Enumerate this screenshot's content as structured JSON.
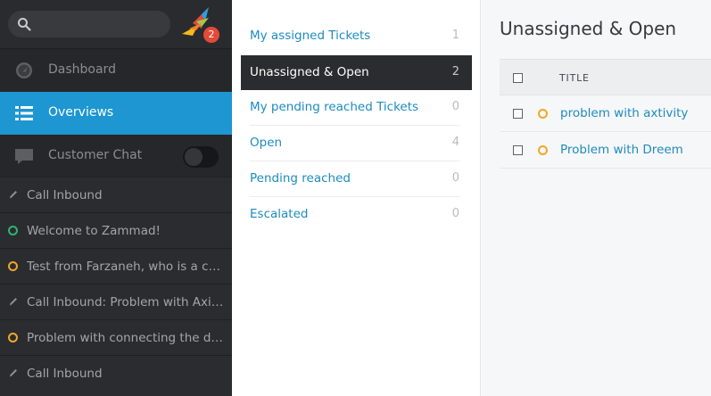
{
  "sidebar": {
    "notification_count": "2",
    "nav": {
      "dashboard": "Dashboard",
      "overviews": "Overviews",
      "customer_chat": "Customer Chat"
    },
    "tasks": [
      {
        "label": "Call Inbound",
        "icon": "pencil-icon"
      },
      {
        "label": "Welcome to Zammad!",
        "icon": "green-ring"
      },
      {
        "label": "Test from Farzaneh, who is a customer",
        "icon": "orange-ring"
      },
      {
        "label": "Call Inbound: Problem with Axitivity",
        "icon": "pencil-icon"
      },
      {
        "label": "Problem with connecting the device",
        "icon": "orange-ring"
      },
      {
        "label": "Call Inbound",
        "icon": "pencil-icon"
      }
    ]
  },
  "overviews": [
    {
      "label": "My assigned Tickets",
      "count": "1"
    },
    {
      "label": "Unassigned & Open",
      "count": "2",
      "active": true
    },
    {
      "label": "My pending reached Tickets",
      "count": "0"
    },
    {
      "label": "Open",
      "count": "4"
    },
    {
      "label": "Pending reached",
      "count": "0"
    },
    {
      "label": "Escalated",
      "count": "0"
    }
  ],
  "main": {
    "title": "Unassigned & Open",
    "column_title": "TITLE",
    "rows": [
      {
        "title": "problem with axtivity"
      },
      {
        "title": "Problem with Dreem"
      }
    ]
  },
  "colors": {
    "accent": "#1d96d2",
    "link": "#1d8bc0",
    "open_state": "#f0a72a",
    "new_state": "#2bb673",
    "sidebar_bg": "#26272a"
  }
}
